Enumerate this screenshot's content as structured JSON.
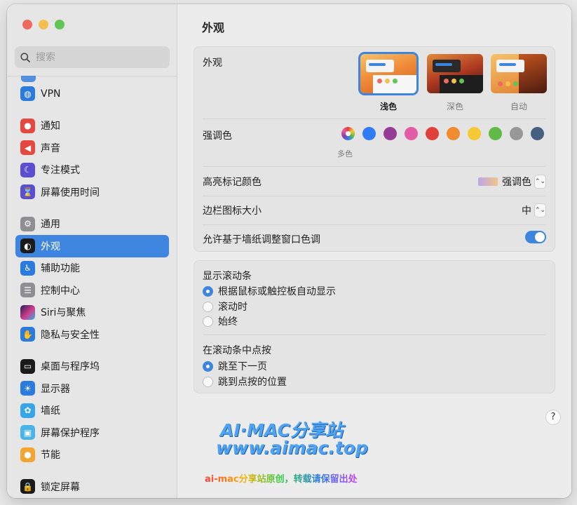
{
  "window": {
    "title": "外观"
  },
  "sidebar": {
    "search_placeholder": "搜索",
    "groups": [
      [
        {
          "label": "VPN",
          "icon": "globe-icon"
        }
      ],
      [
        {
          "label": "通知",
          "icon": "bell-icon"
        },
        {
          "label": "声音",
          "icon": "speaker-icon"
        },
        {
          "label": "专注模式",
          "icon": "moon-icon"
        },
        {
          "label": "屏幕使用时间",
          "icon": "hourglass-icon"
        }
      ],
      [
        {
          "label": "通用",
          "icon": "gear-icon"
        },
        {
          "label": "外观",
          "icon": "appearance-icon",
          "selected": true
        },
        {
          "label": "辅助功能",
          "icon": "accessibility-icon"
        },
        {
          "label": "控制中心",
          "icon": "switches-icon"
        },
        {
          "label": "Siri与聚焦",
          "icon": "siri-icon"
        },
        {
          "label": "隐私与安全性",
          "icon": "hand-icon"
        }
      ],
      [
        {
          "label": "桌面与程序坞",
          "icon": "dock-icon"
        },
        {
          "label": "显示器",
          "icon": "sun-icon"
        },
        {
          "label": "墙纸",
          "icon": "flower-icon"
        },
        {
          "label": "屏幕保护程序",
          "icon": "screensaver-icon"
        },
        {
          "label": "节能",
          "icon": "bulb-icon"
        }
      ],
      [
        {
          "label": "锁定屏幕",
          "icon": "lock-icon"
        }
      ]
    ]
  },
  "appearance": {
    "label": "外观",
    "options": [
      {
        "label": "浅色",
        "selected": true
      },
      {
        "label": "深色",
        "selected": false
      },
      {
        "label": "自动",
        "selected": false
      }
    ]
  },
  "accent": {
    "label": "强调色",
    "selected_label": "多色",
    "colors": [
      "multicolor",
      "#2f7cf6",
      "#953d96",
      "#e45ca5",
      "#e0403c",
      "#f08c30",
      "#f5c936",
      "#62ba46",
      "#989898",
      "#445f80"
    ]
  },
  "highlight": {
    "label": "高亮标记颜色",
    "value": "强调色"
  },
  "sidebar_icon_size": {
    "label": "边栏图标大小",
    "value": "中"
  },
  "wallpaper_tint": {
    "label": "允许基于墙纸调整窗口色调",
    "on": true
  },
  "scrollbars": {
    "label": "显示滚动条",
    "options": [
      {
        "label": "根据鼠标或触控板自动显示",
        "selected": true
      },
      {
        "label": "滚动时",
        "selected": false
      },
      {
        "label": "始终",
        "selected": false
      }
    ]
  },
  "scroll_click": {
    "label": "在滚动条中点按",
    "options": [
      {
        "label": "跳至下一页",
        "selected": true
      },
      {
        "label": "跳到点按的位置",
        "selected": false
      }
    ]
  },
  "help_label": "?",
  "watermark": {
    "line1": "AI·MAC分享站",
    "line2": "www.aimac.top",
    "line3": "ai-mac分享站原创，转载请保留出处"
  }
}
